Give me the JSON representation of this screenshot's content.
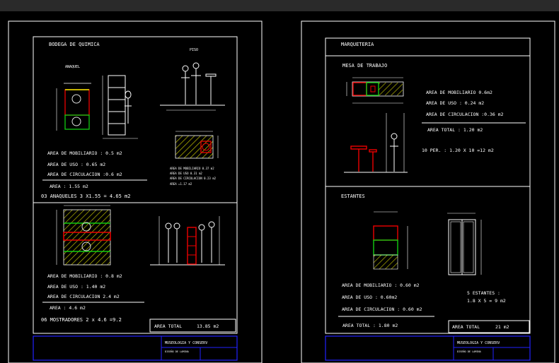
{
  "left_sheet": {
    "section1": {
      "title": "BODEGA DE  QUIMICA",
      "label_anaquel": "ANAQUEL",
      "label_top": "PISO",
      "area_mobiliario": "AREA DE MOBILIARIO  :  0.5  m2",
      "area_uso": "AREA DE USO  :  0.65   m2",
      "area_circulacion": "AREA DE CIRCULACION :0.6  m2",
      "area": "AREA  :  1.55  m2",
      "summary": "03  ANAQUELES     3  X1.55  =  4.65  m2",
      "mini_lines": [
        "AREA DE MOBILIARIO       0.37 m2",
        "AREA DE USO   0.31  m2",
        "AREA DE CIRCULACION  0.23 m2",
        "AREA =1.17 m2"
      ]
    },
    "section2": {
      "area_mobiliario": "AREA DE MOBILIARIO  :  0.8  m2",
      "area_uso": "AREA DE USO  : 1.40   m2",
      "area_circulacion": "AREA DE CIRCULACION  2.4  m2",
      "area": "AREA  : 4.6  m2",
      "summary": "06  MOSTRADORES      2  x  4.6   =9.2",
      "area_total_label": "AREA  TOTAL",
      "area_total_value": "13.85  m2"
    },
    "title_block": {
      "name": "MUSEOLOGIA  Y  CONSERV",
      "sub": "DISEÑO DE LAMINA"
    }
  },
  "right_sheet": {
    "header": "MARQUETERIA",
    "section1": {
      "title": "MESA  DE   TRABAJO",
      "area_mobiliario": "AREA DE MOBILIARIO    0.6m2",
      "area_uso": "AREA  DE  USO  :  0.24    m2",
      "area_circulacion": "AREA  DE  CIRCULACION  :0.36  m2",
      "area_total": "AREA  TOTAL  :  1.20  m2",
      "per": "10  PER. :  1.20  X 10  =12  m2"
    },
    "section2": {
      "title": "ESTANTES",
      "area_mobiliario": "AREA  DE  MOBILIARIO  :  0.60 m2",
      "area_uso": "AREA  DE  USO : 0.60m2",
      "area_circulacion": "AREA  DE  CIRCULACION  :  0.60  m2",
      "area_total": "AREA  TOTAL  :  1.80  m2",
      "estantes_line1": "5   ESTANTES   :",
      "estantes_line2": "1.8  X  5   =  9  m2",
      "area_total_label": "AREA  TOTAL",
      "area_total_value": "21   m2"
    },
    "title_block": {
      "name": "MUSEOLOGIA  Y  CONSERV",
      "sub": "DISEÑO DE LAMINA"
    }
  },
  "colors": {
    "background": "#000000",
    "line": "#ffffff",
    "red": "#ff2020",
    "green": "#20c020",
    "yellow": "#e6e600",
    "blue": "#2020ff"
  }
}
